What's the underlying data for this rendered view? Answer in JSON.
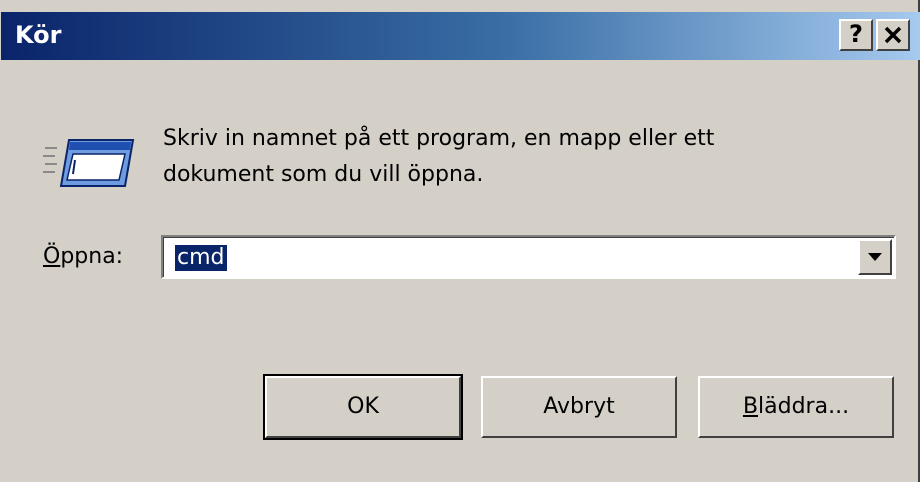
{
  "window": {
    "title": "Kör",
    "help_label": "?",
    "close_label": "×"
  },
  "prompt": {
    "line1": "Skriv in namnet på ett program, en mapp eller ett",
    "line2": "dokument som du vill öppna."
  },
  "open": {
    "label_accel": "Ö",
    "label_rest": "ppna:",
    "value": "cmd"
  },
  "buttons": {
    "ok": "OK",
    "cancel": "Avbryt",
    "browse_accel": "B",
    "browse_rest": "läddra..."
  },
  "icons": {
    "run": "run-program-icon",
    "dropdown": "chevron-down-icon"
  },
  "colors": {
    "title_start": "#0a246a",
    "title_end": "#a6caf0",
    "face": "#d4d0c8",
    "selection": "#0a246a"
  }
}
